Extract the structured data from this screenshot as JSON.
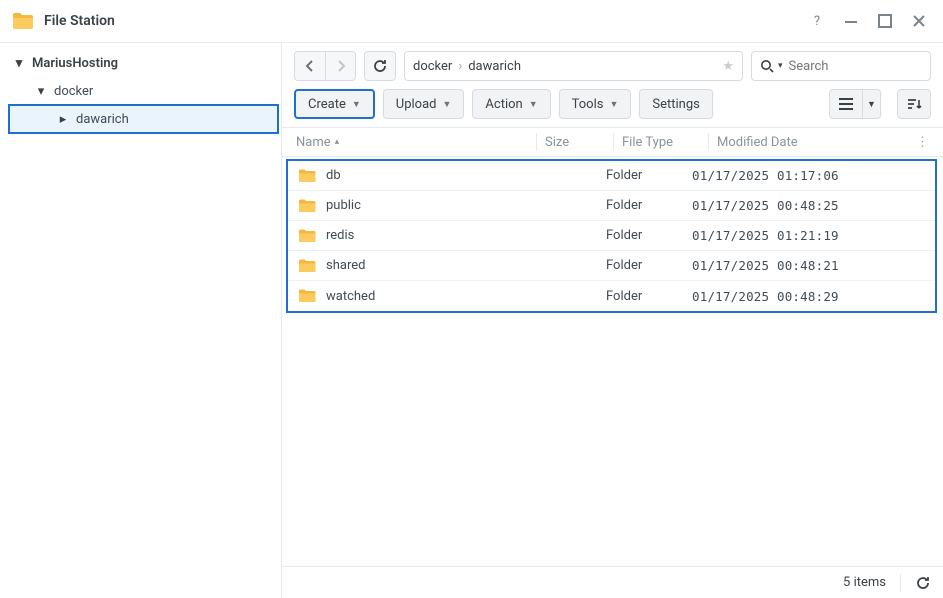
{
  "window": {
    "title": "File Station"
  },
  "tree": {
    "root": "MariusHosting",
    "level1": "docker",
    "level2": "dawarich"
  },
  "breadcrumb": {
    "seg1": "docker",
    "seg2": "dawarich"
  },
  "search": {
    "placeholder": "Search"
  },
  "toolbar": {
    "create": "Create",
    "upload": "Upload",
    "action": "Action",
    "tools": "Tools",
    "settings": "Settings"
  },
  "columns": {
    "name": "Name",
    "size": "Size",
    "type": "File Type",
    "modified": "Modified Date"
  },
  "rows": [
    {
      "name": "db",
      "type": "Folder",
      "modified": "01/17/2025 01:17:06"
    },
    {
      "name": "public",
      "type": "Folder",
      "modified": "01/17/2025 00:48:25"
    },
    {
      "name": "redis",
      "type": "Folder",
      "modified": "01/17/2025 01:21:19"
    },
    {
      "name": "shared",
      "type": "Folder",
      "modified": "01/17/2025 00:48:21"
    },
    {
      "name": "watched",
      "type": "Folder",
      "modified": "01/17/2025 00:48:29"
    }
  ],
  "status": {
    "count": "5 items"
  }
}
